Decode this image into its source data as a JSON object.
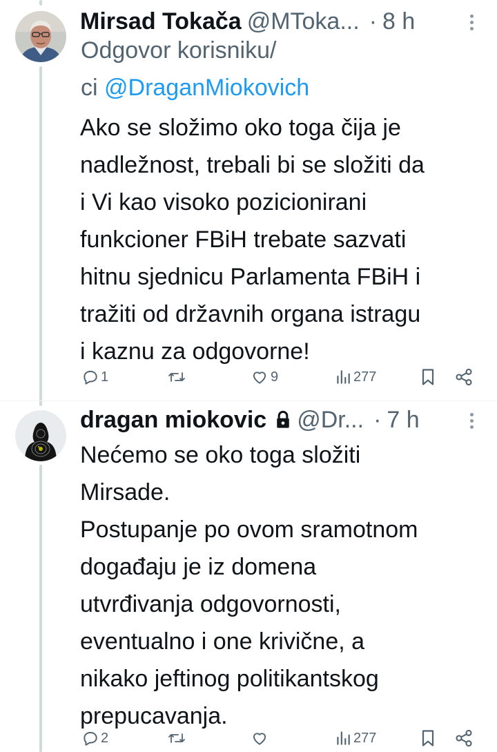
{
  "tweets": [
    {
      "author_name": "Mirsad Tokača",
      "handle": "@MToka...",
      "dot": "·",
      "time": "8 h",
      "reply_prefix": "Odgovor korisniku/",
      "reply_prefix2": "ci ",
      "reply_mention": "@DraganMiokovich",
      "text": "Ako se složimo oko toga čija je\nnadležnost, trebali bi se složiti da\ni Vi kao visoko pozicionirani\nfunkcioner FBiH trebate sazvati\nhitnu sjednicu Parlamenta FBiH i\ntražiti od državnih organa istragu\ni kaznu za odgovorne!",
      "replies": "1",
      "retweets": "",
      "likes": "9",
      "views": "277",
      "icons": {
        "reply": "comment-icon",
        "retweet": "retweet-icon",
        "like": "heart-icon",
        "views": "views-icon",
        "bookmark": "bookmark-icon",
        "share": "share-icon",
        "more": "more-icon"
      }
    },
    {
      "author_name": "dragan miokovic",
      "protected": true,
      "handle": "@Dr...",
      "dot": "·",
      "time": "7 h",
      "text": "Nećemo se oko toga složiti\nMirsade.\nPostupanje po ovom sramotnom\ndogađaju je iz domena\nutvrđivanja odgovornosti,\neventualno i one krivične, a\nnikako jeftinog politikantskog\nprepucavanja.",
      "replies": "2",
      "retweets": "",
      "likes": "",
      "views": "277",
      "icons": {
        "lock": "lock-icon",
        "reply": "comment-icon",
        "retweet": "retweet-icon",
        "like": "heart-icon",
        "views": "views-icon",
        "bookmark": "bookmark-icon",
        "share": "share-icon",
        "more": "more-icon"
      }
    }
  ],
  "colors": {
    "text": "#0f1419",
    "secondary": "#536471",
    "link": "#1d9bf0",
    "thread_line": "#cfd9de",
    "background": "#ffffff"
  }
}
